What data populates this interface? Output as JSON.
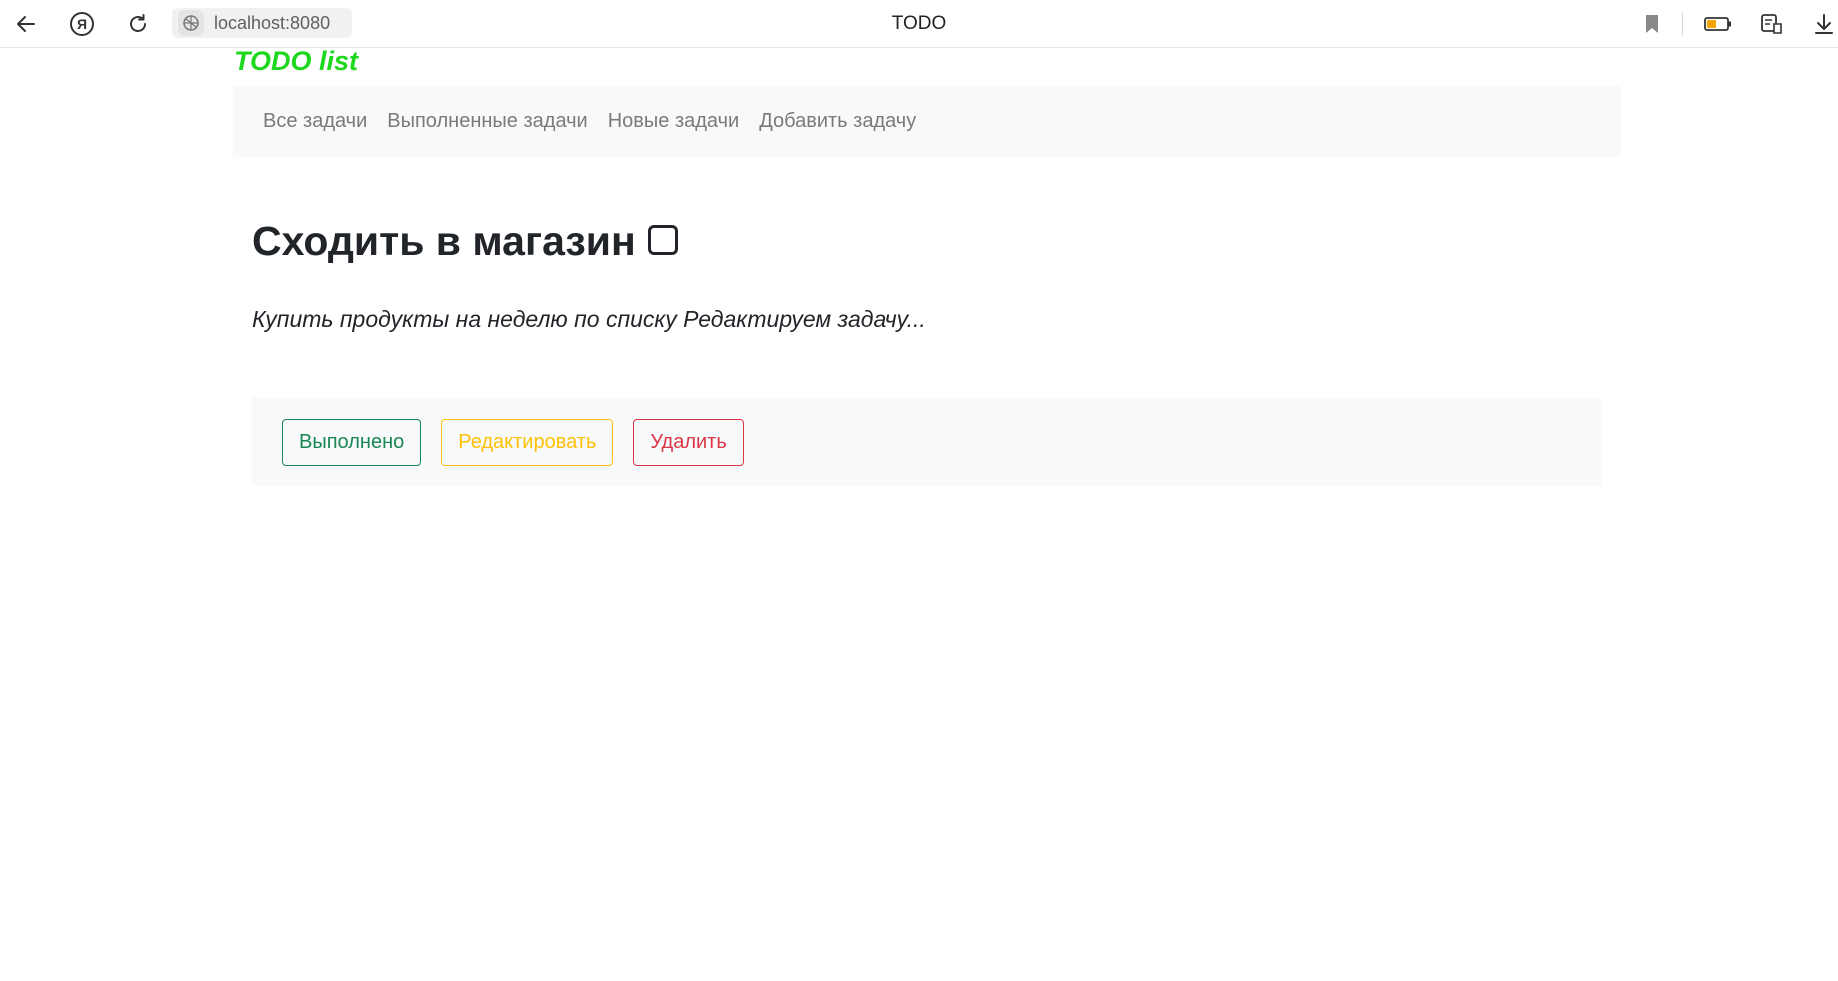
{
  "browser": {
    "url": "localhost:8080",
    "tab_title": "TODO",
    "icons": [
      "back-arrow-icon",
      "yandex-icon",
      "reload-icon",
      "site-info-icon",
      "bookmark-icon",
      "battery-icon",
      "reader-mode-icon",
      "download-icon"
    ]
  },
  "brand": {
    "title": "TODO list",
    "color": "#1ed81e"
  },
  "navbar": {
    "links": [
      {
        "label": "Все задачи"
      },
      {
        "label": "Выполненные задачи"
      },
      {
        "label": "Новые задачи"
      },
      {
        "label": "Добавить задачу"
      }
    ]
  },
  "task": {
    "title": "Сходить в магазин",
    "done": false,
    "description": "Купить продукты на неделю по списку Редактируем задачу..."
  },
  "actions": {
    "done_label": "Выполнено",
    "edit_label": "Редактировать",
    "delete_label": "Удалить",
    "colors": {
      "success": "#198754",
      "warning": "#ffc107",
      "danger": "#dc3545"
    }
  }
}
